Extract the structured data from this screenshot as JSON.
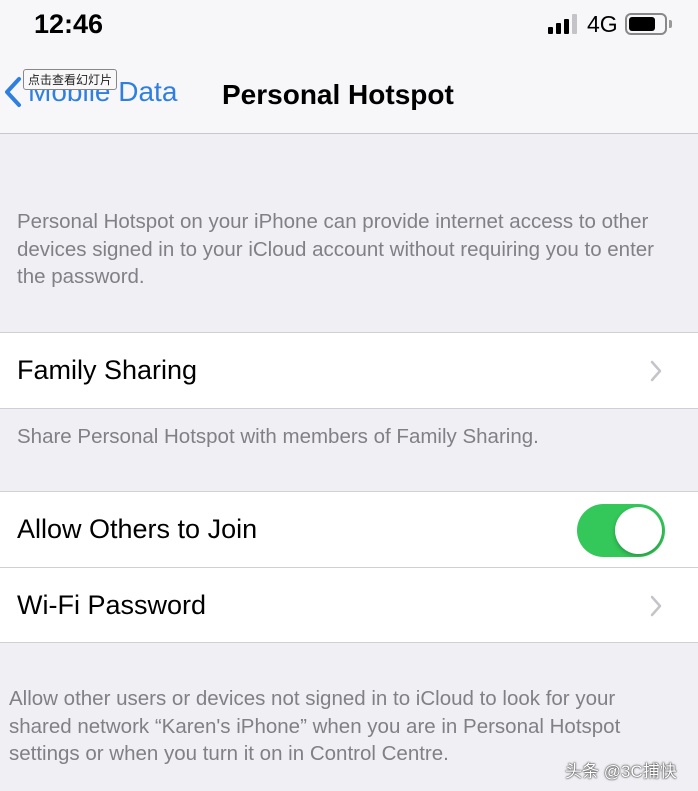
{
  "status_bar": {
    "time": "12:46",
    "network": "4G",
    "signal_bars": 3,
    "signal_max": 4,
    "battery_level": 0.75
  },
  "nav": {
    "back_label": "Mobile Data",
    "title": "Personal Hotspot",
    "tooltip": "点击查看幻灯片"
  },
  "sections": {
    "intro": "Personal Hotspot on your iPhone can provide internet access to other devices signed in to your iCloud account without requiring you to enter the password.",
    "family_sharing": {
      "label": "Family Sharing",
      "footer": "Share Personal Hotspot with members of Family Sharing."
    },
    "allow_others": {
      "label": "Allow Others to Join",
      "enabled": true,
      "color": "#34c759"
    },
    "wifi_password": {
      "label": "Wi-Fi Password"
    },
    "footer": "Allow other users or devices not signed in to iCloud to look for your shared network “Karen's iPhone” when you are in Personal Hotspot settings or when you turn it on in Control Centre."
  },
  "watermark": "头条 @3C捕快"
}
